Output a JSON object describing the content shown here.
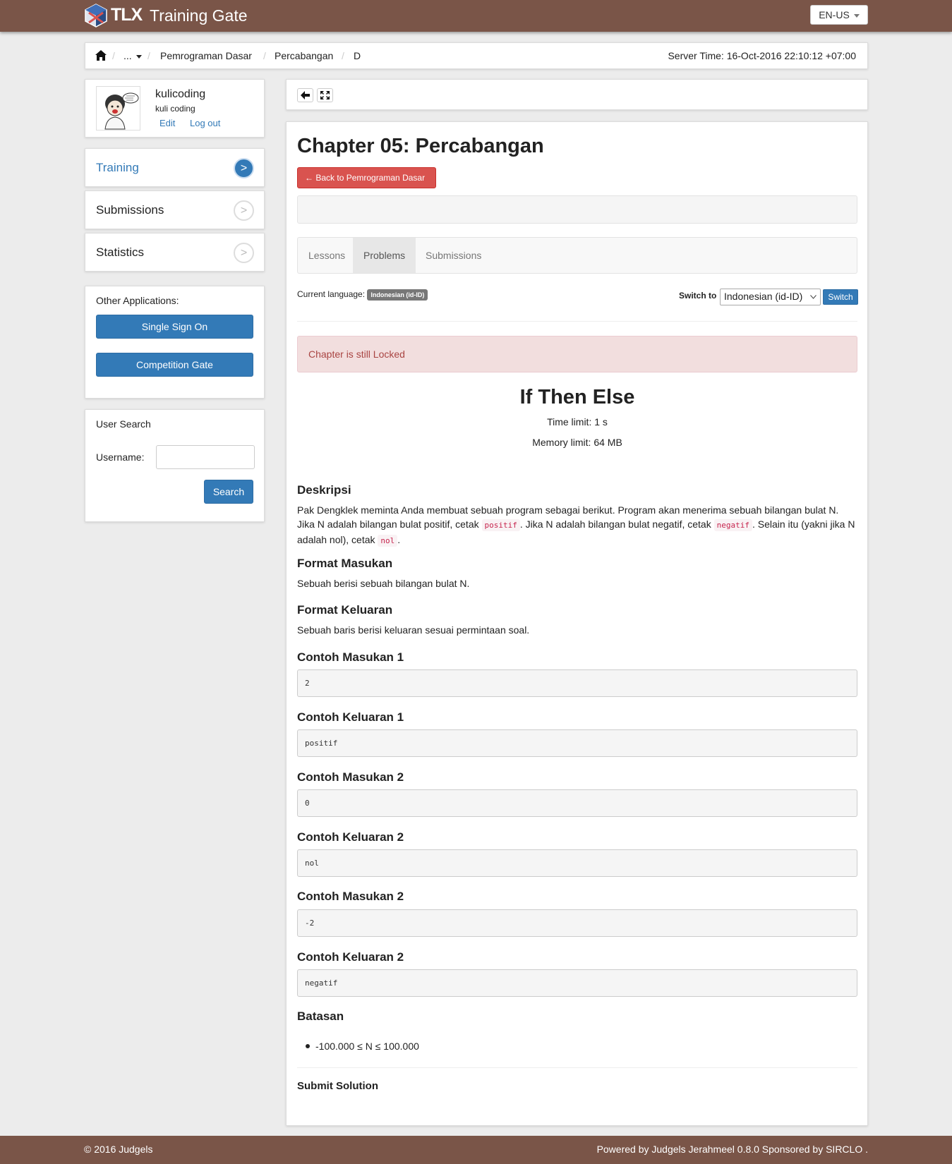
{
  "header": {
    "logo_text": "TLX",
    "app_title": "Training Gate",
    "language": "EN-US"
  },
  "breadcrumb": {
    "more": "...",
    "items": [
      "Pemrograman Dasar",
      "Percabangan",
      "D"
    ],
    "server_time": "Server Time: 16-Oct-2016 22:10:12 +07:00"
  },
  "user": {
    "username": "kulicoding",
    "real_name": "kuli coding",
    "edit_label": "Edit",
    "logout_label": "Log out"
  },
  "nav": [
    {
      "label": "Training",
      "arrow": ">"
    },
    {
      "label": "Submissions",
      "arrow": ">"
    },
    {
      "label": "Statistics",
      "arrow": ">"
    }
  ],
  "other_apps": {
    "title": "Other Applications:",
    "sso": "Single Sign On",
    "competition": "Competition Gate"
  },
  "user_search": {
    "title": "User Search",
    "username_label": "Username:",
    "button": "Search"
  },
  "chapter": {
    "title": "Chapter 05: Percabangan",
    "back_label": "Back to Pemrograman Dasar",
    "tabs": [
      "Lessons",
      "Problems",
      "Submissions"
    ],
    "current_language_label": "Current language:",
    "current_language": "Indonesian (id-ID)",
    "switch_to_label": "Switch to",
    "switch_selected": "Indonesian (id-ID)",
    "switch_button": "Switch",
    "locked_alert": "Chapter is still Locked"
  },
  "problem": {
    "title": "If Then Else",
    "time_limit": "Time limit: 1 s",
    "memory_limit": "Memory limit: 64 MB",
    "desc_heading": "Deskripsi",
    "desc_text_1": "Pak Dengklek meminta Anda membuat sebuah program sebagai berikut. Program akan menerima sebuah bilangan bulat N. Jika N adalah bilangan bulat positif, cetak",
    "desc_code_1": "positif",
    "desc_text_2": ". Jika N adalah bilangan bulat negatif, cetak",
    "desc_code_2": "negatif",
    "desc_text_3": ". Selain itu (yakni jika N adalah nol), cetak",
    "desc_code_3": "nol",
    "desc_text_4": ".",
    "input_heading": "Format Masukan",
    "input_text": "Sebuah berisi sebuah bilangan bulat N.",
    "output_heading": "Format Keluaran",
    "output_text": "Sebuah baris berisi keluaran sesuai permintaan soal.",
    "samples": [
      {
        "heading": "Contoh Masukan 1",
        "value": "2"
      },
      {
        "heading": "Contoh Keluaran 1",
        "value": "positif"
      },
      {
        "heading": "Contoh Masukan 2",
        "value": "0"
      },
      {
        "heading": "Contoh Keluaran 2",
        "value": "nol"
      },
      {
        "heading": "Contoh Masukan 2",
        "value": "-2"
      },
      {
        "heading": "Contoh Keluaran 2",
        "value": "negatif"
      }
    ],
    "constraints_heading": "Batasan",
    "constraint_1": "-100.000 ≤ N ≤ 100.000",
    "submit_heading": "Submit Solution"
  },
  "footer": {
    "copyright": "© 2016 Judgels",
    "powered": "Powered by Judgels Jerahmeel 0.8.0 Sponsored by SIRCLO ."
  },
  "colors": {
    "brand": "#7a5548",
    "primary": "#337ab7",
    "danger": "#d9534f"
  }
}
